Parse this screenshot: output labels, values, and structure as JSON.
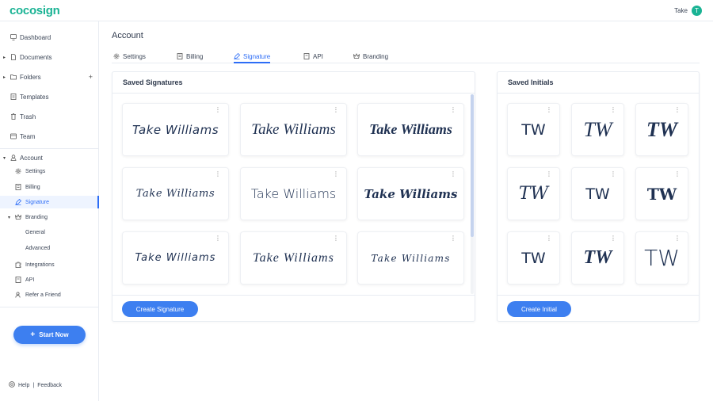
{
  "app": {
    "logo": "cocosign",
    "user_name": "Take",
    "user_initial": "T"
  },
  "sidebar": {
    "dashboard": "Dashboard",
    "documents": "Documents",
    "folders": "Folders",
    "templates": "Templates",
    "trash": "Trash",
    "team": "Team",
    "account": "Account",
    "account_items": {
      "settings": "Settings",
      "billing": "Billing",
      "signature": "Signature",
      "branding": "Branding",
      "general": "General",
      "advanced": "Advanced",
      "integrations": "Integrations",
      "api": "API",
      "refer": "Refer a Friend"
    },
    "start_now": "Start Now",
    "help": "Help",
    "separator": "|",
    "feedback": "Feedback"
  },
  "main": {
    "title": "Account",
    "tabs": [
      "Settings",
      "Billing",
      "Signature",
      "API",
      "Branding"
    ],
    "active_tab": "Signature"
  },
  "signatures": {
    "title": "Saved Signatures",
    "items": [
      "Take Williams",
      "Take Williams",
      "Take Williams",
      "Take Williams",
      "Take Williams",
      "Take Williams",
      "Take Williams",
      "Take Williams",
      "Take Williams"
    ],
    "create_label": "Create Signature"
  },
  "initials": {
    "title": "Saved Initials",
    "items": [
      "TW",
      "TW",
      "TW",
      "TW",
      "TW",
      "TW",
      "TW",
      "TW",
      "TW"
    ],
    "create_label": "Create Initial"
  },
  "colors": {
    "accent": "#3d7ff0",
    "brand": "#1ab394",
    "ink": "#1f3152"
  }
}
